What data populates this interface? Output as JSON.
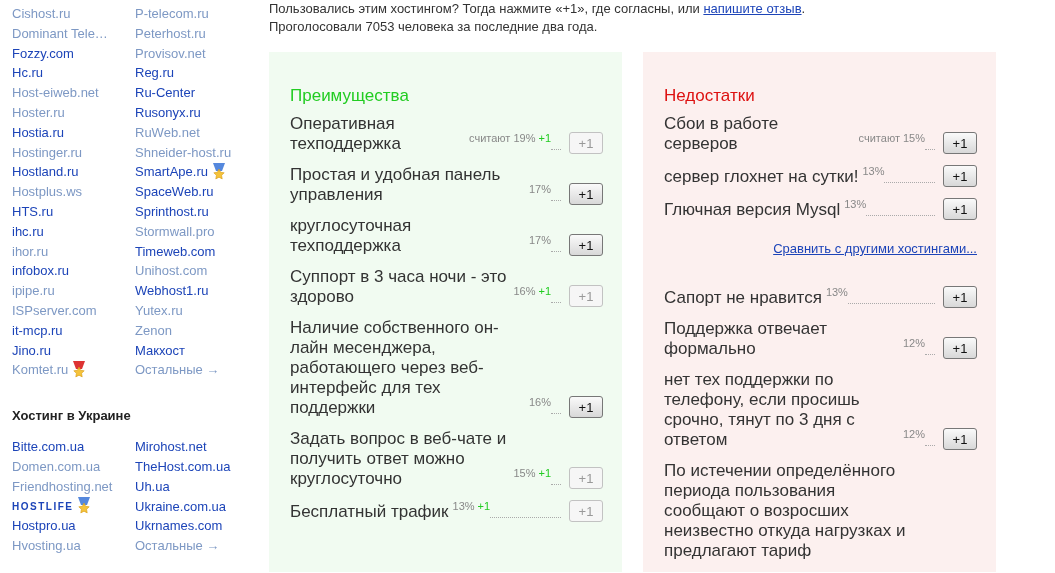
{
  "sidebar": {
    "columns": [
      [
        {
          "label": "Cishost.ru",
          "muted": true
        },
        {
          "label": "Dominant Tele…",
          "muted": true
        },
        {
          "label": "Fozzy.com",
          "muted": false
        },
        {
          "label": "Hc.ru",
          "muted": false
        },
        {
          "label": "Host-eiweb.net",
          "muted": true
        },
        {
          "label": "Hoster.ru",
          "muted": true
        },
        {
          "label": "Hostia.ru",
          "muted": false
        },
        {
          "label": "Hostinger.ru",
          "muted": true
        },
        {
          "label": "Hostland.ru",
          "muted": false
        },
        {
          "label": "Hostplus.ws",
          "muted": true
        },
        {
          "label": "HTS.ru",
          "muted": false
        },
        {
          "label": "ihc.ru",
          "muted": false
        },
        {
          "label": "ihor.ru",
          "muted": true
        },
        {
          "label": "infobox.ru",
          "muted": false
        },
        {
          "label": "ipipe.ru",
          "muted": true
        },
        {
          "label": "ISPserver.com",
          "muted": true
        },
        {
          "label": "it-mcp.ru",
          "muted": false
        },
        {
          "label": "Jino.ru",
          "muted": false
        },
        {
          "label": "Komtet.ru",
          "muted": true,
          "medal": true,
          "color": "#dd3333"
        }
      ],
      [
        {
          "label": "P-telecom.ru",
          "muted": true
        },
        {
          "label": "Peterhost.ru",
          "muted": true
        },
        {
          "label": "Provisov.net",
          "muted": true
        },
        {
          "label": "Reg.ru",
          "muted": false
        },
        {
          "label": "Ru-Center",
          "muted": false
        },
        {
          "label": "Rusonyx.ru",
          "muted": false
        },
        {
          "label": "RuWeb.net",
          "muted": true
        },
        {
          "label": "Shneider-host.ru",
          "muted": true
        },
        {
          "label": "SmartApe.ru",
          "muted": false,
          "medal": true,
          "color": "#5588dd"
        },
        {
          "label": "SpaceWeb.ru",
          "muted": false
        },
        {
          "label": "Sprinthost.ru",
          "muted": false
        },
        {
          "label": "Stormwall.pro",
          "muted": true
        },
        {
          "label": "Timeweb.com",
          "muted": false
        },
        {
          "label": "Unihost.com",
          "muted": true
        },
        {
          "label": "Webhost1.ru",
          "muted": false
        },
        {
          "label": "Yutex.ru",
          "muted": true
        },
        {
          "label": "Zenon",
          "muted": true
        },
        {
          "label": "Макхост",
          "muted": false
        },
        {
          "label": "Остальные →",
          "muted": true
        }
      ]
    ]
  },
  "ukraine": {
    "title": "Хостинг в Украине",
    "columns": [
      [
        {
          "label": "Bitte.com.ua",
          "muted": false
        },
        {
          "label": "Domen.com.ua",
          "muted": true
        },
        {
          "label": "Friendhosting.net",
          "muted": true
        },
        {
          "label": "HOSTLIFE",
          "muted": false,
          "kind": "logo",
          "medal": true,
          "color": "#5588dd"
        },
        {
          "label": "Hostpro.ua",
          "muted": false
        },
        {
          "label": "Hvosting.ua",
          "muted": true
        }
      ],
      [
        {
          "label": "Mirohost.net",
          "muted": false
        },
        {
          "label": "TheHost.com.ua",
          "muted": false
        },
        {
          "label": "Uh.ua",
          "muted": false
        },
        {
          "label": "Ukraine.com.ua",
          "muted": false
        },
        {
          "label": "Ukrnames.com",
          "muted": false
        },
        {
          "label": "Остальные →",
          "muted": true
        }
      ]
    ]
  },
  "intro": {
    "line_1": "Пользовались этим хостингом? Тогда нажмите «+1», где согласны, или ",
    "line_1_link": "напишите отзыв",
    "line_1_end": ".",
    "line_2": "Проголосовали 7053 человека за последние два года."
  },
  "pros": {
    "title": "Преимущества",
    "items": [
      {
        "kind": "item",
        "text": "Оперативная техподдержка",
        "stat": "считают 19%",
        "plus": "+1",
        "button": "+1",
        "disabled": true
      },
      {
        "kind": "item",
        "text": "Простая и удобная панель управления",
        "stat": "17%",
        "button": "+1",
        "disabled": false
      },
      {
        "kind": "item",
        "text": "круглосуточная техподдержка",
        "stat": "17%",
        "button": "+1",
        "disabled": false
      },
      {
        "kind": "item",
        "text": "Суппорт в 3 часа ночи - это здорово",
        "stat": "16%",
        "plus": "+1",
        "button": "+1",
        "disabled": true
      },
      {
        "kind": "item",
        "text": "Наличие собственного он-лайн месенджера, работающего через веб-интерфейс для тех поддержки",
        "stat": "16%",
        "button": "+1",
        "disabled": false
      },
      {
        "kind": "item",
        "text": "Задать вопрос в веб-чате и получить ответ можно круглосуточно",
        "stat": "15%",
        "plus": "+1",
        "button": "+1",
        "disabled": true
      },
      {
        "kind": "item",
        "text": "Бесплатный трафик",
        "stat": "13%",
        "plus": "+1",
        "button": "+1",
        "disabled": true
      }
    ]
  },
  "cons": {
    "title": "Недостатки",
    "items": [
      {
        "kind": "item",
        "text": "Сбои в работе серверов",
        "stat": "считают 15%",
        "button": "+1",
        "disabled": false
      },
      {
        "kind": "item",
        "text": "сервер глохнет на сутки!",
        "stat": "13%",
        "button": "+1",
        "disabled": false
      },
      {
        "kind": "item",
        "text": "Глючная версия Mysql",
        "stat": "13%",
        "button": "+1",
        "disabled": false
      },
      {
        "kind": "link",
        "text": "Сравнить с другими хостингами..."
      },
      {
        "kind": "item",
        "text": "Сапорт не нравится",
        "stat": "13%",
        "button": "+1",
        "disabled": false
      },
      {
        "kind": "item",
        "text": "Поддержка отвечает формально",
        "stat": "12%",
        "button": "+1",
        "disabled": false
      },
      {
        "kind": "item",
        "text": "нет тех поддержки по телефону, если просишь срочно, тянут по 3 дня с ответом",
        "stat": "12%",
        "button": "+1",
        "disabled": false
      },
      {
        "kind": "text",
        "text": "По истечении определённого периода пользования сообщают о возросших неизвестно откуда нагрузках и предлагают тариф"
      }
    ]
  }
}
